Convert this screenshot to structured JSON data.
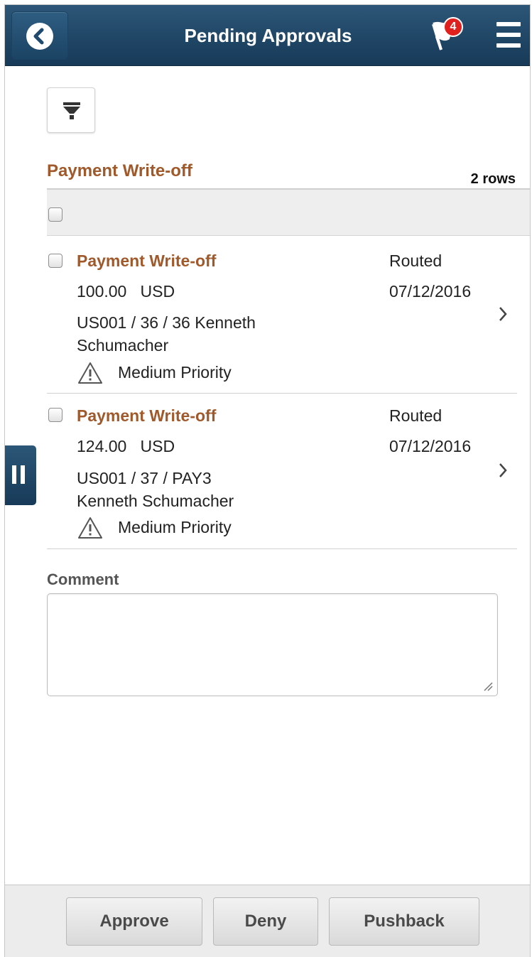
{
  "header": {
    "title": "Pending Approvals",
    "notification_count": "4",
    "back_icon": "back-arrow-icon",
    "menu_icon": "hamburger-menu-icon",
    "brand_color": "#1f4a6e"
  },
  "filter": {
    "icon": "filter-icon"
  },
  "section": {
    "title": "Payment Write-off",
    "row_count": "2 rows",
    "accent_color": "#a0592a"
  },
  "items": [
    {
      "title": "Payment Write-off",
      "amount": "100.00   USD",
      "reference_line1": "US001 / 36 / 36  Kenneth",
      "reference_line2": "Schumacher",
      "priority": "Medium Priority",
      "status": "Routed",
      "date": "07/12/2016"
    },
    {
      "title": "Payment Write-off",
      "amount": "124.00   USD",
      "reference_line1": "US001 / 37 / PAY3",
      "reference_line2": "Kenneth Schumacher",
      "priority": "Medium Priority",
      "status": "Routed",
      "date": "07/12/2016"
    }
  ],
  "comment": {
    "label": "Comment",
    "value": ""
  },
  "footer": {
    "approve_label": "Approve",
    "deny_label": "Deny",
    "pushback_label": "Pushback"
  }
}
